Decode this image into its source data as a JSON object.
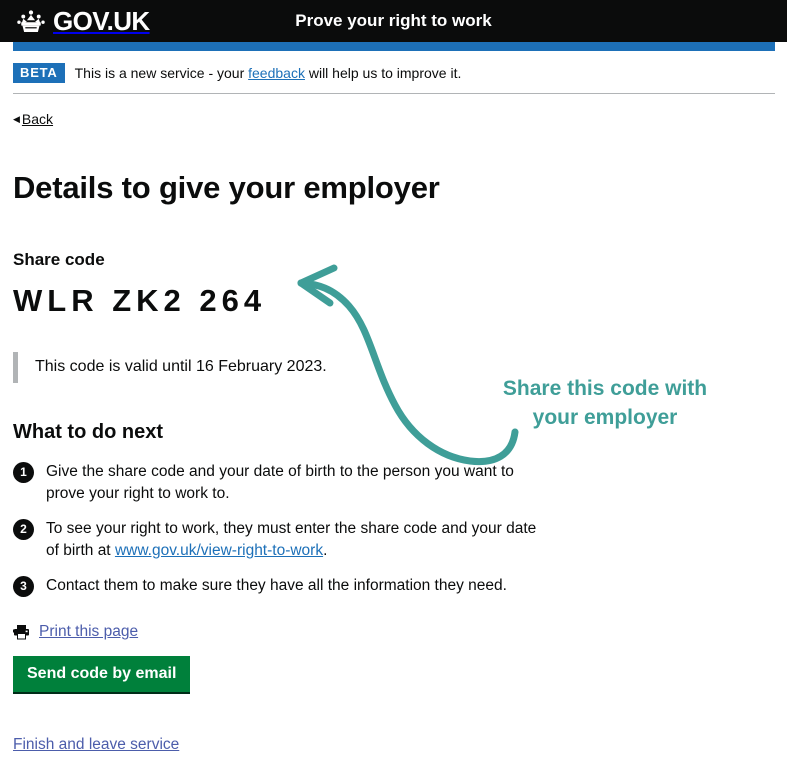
{
  "header": {
    "logo_text": "GOV.UK",
    "crown_icon": "crown-icon",
    "service_name": "Prove your right to work"
  },
  "phase_banner": {
    "tag": "BETA",
    "text_before": "This is a new service - your ",
    "link": "feedback",
    "text_after": " will help us to improve it."
  },
  "back_link": {
    "caret": "◀",
    "label": "Back"
  },
  "main": {
    "page_title": "Details to give your employer",
    "share_code_label": "Share code",
    "share_code": "WLR ZK2 264",
    "inset_text": "This code is valid until 16 February 2023.",
    "what_next_heading": "What to do next",
    "steps": [
      {
        "number": "1",
        "text": "Give the share code and your date of birth to the person you want to prove your right to work to.",
        "link": null,
        "text_after": null
      },
      {
        "number": "2",
        "text": "To see your right to work, they must enter the share code and your date of birth at ",
        "link": "www.gov.uk/view-right-to-work",
        "text_after": "."
      },
      {
        "number": "3",
        "text": "Contact them to make sure they have all the information they need.",
        "link": null,
        "text_after": null
      }
    ],
    "print_link": "Print this page",
    "printer_icon": "printer-icon",
    "send_email_button": "Send code by email",
    "finish_link": "Finish and leave service"
  },
  "annotation": {
    "line1": "Share this code with",
    "line2": "your employer",
    "arrow_icon": "curved-arrow-icon",
    "color": "#3f9e98"
  },
  "colors": {
    "header_black": "#0b0c0c",
    "brand_blue": "#1d70b8",
    "button_green": "#00803b",
    "link_visited": "#4c5dab",
    "inset_border": "#b1b4b6",
    "annotation_teal": "#3f9e98"
  }
}
